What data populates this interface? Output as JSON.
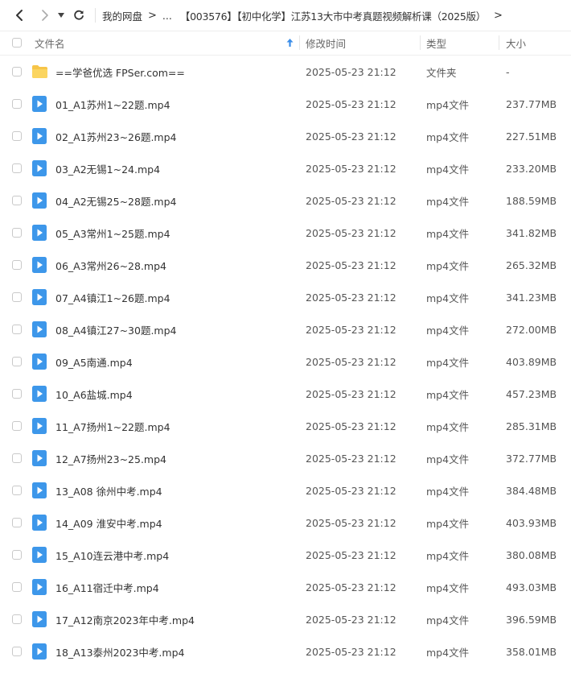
{
  "nav": {
    "back_icon": "chevron-left-icon",
    "forward_icon": "chevron-right-icon",
    "dropdown_icon": "caret-down-icon",
    "refresh_icon": "refresh-icon"
  },
  "breadcrumb": {
    "root": "我的网盘",
    "ellipsis": "...",
    "current": "【003576】【初中化学】江苏13大市中考真题视频解析课（2025版）",
    "separator": ">"
  },
  "columns": {
    "name": "文件名",
    "modified": "修改时间",
    "type": "类型",
    "size": "大小",
    "sort_icon": "sort-ascending-icon"
  },
  "colors": {
    "folder": "#f7c548",
    "video": "#3d97ea",
    "sort_arrow": "#3b8ee8"
  },
  "files": [
    {
      "kind": "folder",
      "name": "==学爸优选 FPSer.com==",
      "modified": "2025-05-23 21:12",
      "type": "文件夹",
      "size": "-"
    },
    {
      "kind": "video",
      "name": "01_A1苏州1~22题.mp4",
      "modified": "2025-05-23 21:12",
      "type": "mp4文件",
      "size": "237.77MB"
    },
    {
      "kind": "video",
      "name": "02_A1苏州23~26题.mp4",
      "modified": "2025-05-23 21:12",
      "type": "mp4文件",
      "size": "227.51MB"
    },
    {
      "kind": "video",
      "name": "03_A2无锡1~24.mp4",
      "modified": "2025-05-23 21:12",
      "type": "mp4文件",
      "size": "233.20MB"
    },
    {
      "kind": "video",
      "name": "04_A2无锡25~28题.mp4",
      "modified": "2025-05-23 21:12",
      "type": "mp4文件",
      "size": "188.59MB"
    },
    {
      "kind": "video",
      "name": "05_A3常州1~25题.mp4",
      "modified": "2025-05-23 21:12",
      "type": "mp4文件",
      "size": "341.82MB"
    },
    {
      "kind": "video",
      "name": "06_A3常州26~28.mp4",
      "modified": "2025-05-23 21:12",
      "type": "mp4文件",
      "size": "265.32MB"
    },
    {
      "kind": "video",
      "name": "07_A4镇江1~26题.mp4",
      "modified": "2025-05-23 21:12",
      "type": "mp4文件",
      "size": "341.23MB"
    },
    {
      "kind": "video",
      "name": "08_A4镇江27~30题.mp4",
      "modified": "2025-05-23 21:12",
      "type": "mp4文件",
      "size": "272.00MB"
    },
    {
      "kind": "video",
      "name": "09_A5南通.mp4",
      "modified": "2025-05-23 21:12",
      "type": "mp4文件",
      "size": "403.89MB"
    },
    {
      "kind": "video",
      "name": "10_A6盐城.mp4",
      "modified": "2025-05-23 21:12",
      "type": "mp4文件",
      "size": "457.23MB"
    },
    {
      "kind": "video",
      "name": "11_A7扬州1~22题.mp4",
      "modified": "2025-05-23 21:12",
      "type": "mp4文件",
      "size": "285.31MB"
    },
    {
      "kind": "video",
      "name": "12_A7扬州23~25.mp4",
      "modified": "2025-05-23 21:12",
      "type": "mp4文件",
      "size": "372.77MB"
    },
    {
      "kind": "video",
      "name": "13_A08  徐州中考.mp4",
      "modified": "2025-05-23 21:12",
      "type": "mp4文件",
      "size": "384.48MB"
    },
    {
      "kind": "video",
      "name": "14_A09  淮安中考.mp4",
      "modified": "2025-05-23 21:12",
      "type": "mp4文件",
      "size": "403.93MB"
    },
    {
      "kind": "video",
      "name": "15_A10连云港中考.mp4",
      "modified": "2025-05-23 21:12",
      "type": "mp4文件",
      "size": "380.08MB"
    },
    {
      "kind": "video",
      "name": "16_A11宿迁中考.mp4",
      "modified": "2025-05-23 21:12",
      "type": "mp4文件",
      "size": "493.03MB"
    },
    {
      "kind": "video",
      "name": "17_A12南京2023年中考.mp4",
      "modified": "2025-05-23 21:12",
      "type": "mp4文件",
      "size": "396.59MB"
    },
    {
      "kind": "video",
      "name": "18_A13泰州2023中考.mp4",
      "modified": "2025-05-23 21:12",
      "type": "mp4文件",
      "size": "358.01MB"
    }
  ]
}
